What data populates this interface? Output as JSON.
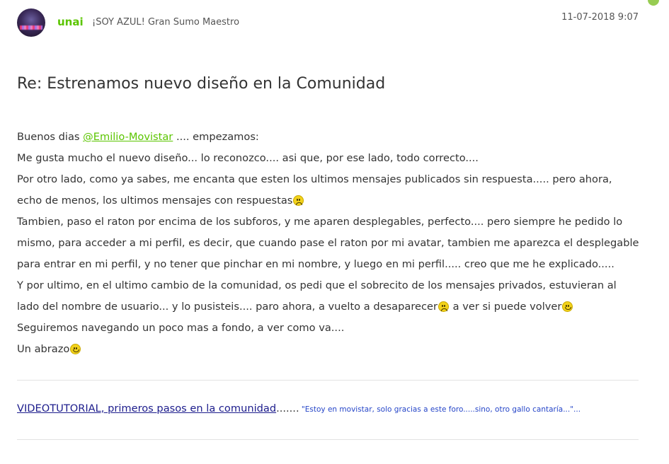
{
  "author": {
    "username": "unai",
    "rank": "¡SOY AZUL! Gran Sumo Maestro"
  },
  "post": {
    "date": "11-07-2018 9:07",
    "title": "Re: Estrenamos nuevo diseño en la Comunidad",
    "body": {
      "l1_before": "Buenos dias ",
      "l1_mention": "@Emilio-Movistar",
      "l1_after": " .... empezamos:",
      "l2": "Me gusta mucho el nuevo diseño... lo reconozco.... asi que, por ese lado, todo correcto....",
      "l3": "Por otro lado, como ya sabes, me encanta que esten los ultimos mensajes publicados sin respuesta..... pero ahora, echo de menos, los ultimos mensajes con respuestas",
      "l4": "Tambien, paso el raton por encima de los subforos, y me aparen desplegables, perfecto.... pero siempre he pedido lo mismo, para acceder a mi perfil, es decir, que cuando pase el raton por mi avatar, tambien me aparezca el desplegable para entrar en mi perfil, y no tener que pinchar en mi nombre, y luego en mi perfil..... creo que me he explicado.....",
      "l5_a": "Y por ultimo, en el ultimo cambio de la comunidad, os pedi que el sobrecito de los mensajes privados, estuvieran al lado del nombre de usuario... y lo pusisteis.... paro ahora, a vuelto a desaparecer",
      "l5_b": " a ver si puede volver",
      "l6": "Seguiremos navegando un poco mas a fondo, a ver como va....",
      "l7": "Un abrazo"
    }
  },
  "signature": {
    "link_text": "VIDEOTUTORIAL, primeros pasos en la comunidad",
    "dots": ".......",
    "quote": " \"Estoy en movistar, solo gracias a este foro.....sino, otro gallo cantaría...\"..."
  },
  "icons": {
    "sad_emoji": "sad-face-emoji",
    "smile_emoji": "smile-face-emoji"
  }
}
